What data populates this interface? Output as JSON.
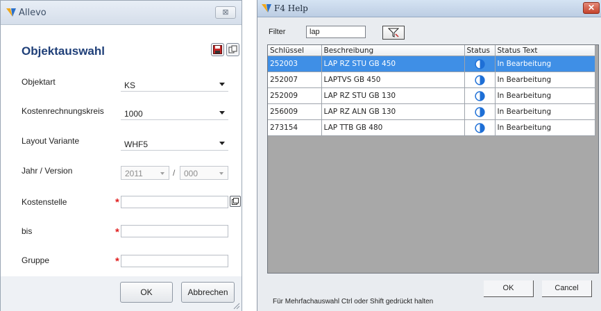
{
  "allevo": {
    "title": "Allevo",
    "close_label": "⊠",
    "heading": "Objektauswahl",
    "fields": {
      "objektart": {
        "label": "Objektart",
        "value": "KS"
      },
      "kostenrechnungskreis": {
        "label": "Kostenrechnungskreis",
        "value": "1000"
      },
      "layout_variante": {
        "label": "Layout Variante",
        "value": "WHF5"
      },
      "jahr_version": {
        "label": "Jahr / Version",
        "year": "2011",
        "separator": "/",
        "version": "000"
      },
      "kostenstelle": {
        "label": "Kostenstelle",
        "value": ""
      },
      "bis": {
        "label": "bis",
        "value": ""
      },
      "gruppe": {
        "label": "Gruppe",
        "value": ""
      }
    },
    "required_marker": "*",
    "ok_label": "OK",
    "cancel_label": "Abbrechen",
    "icons": [
      "allevo-logo-icon",
      "close-icon",
      "save-icon",
      "copy-icon",
      "value-help-icon",
      "resize-grip-icon"
    ]
  },
  "f4": {
    "title": "F4 Help",
    "close_label": "✕",
    "filter_label": "Filter",
    "filter_value": "lap",
    "columns": [
      "Schlüssel",
      "Beschreibung",
      "Status",
      "Status Text"
    ],
    "rows": [
      {
        "key": "252003",
        "desc": "LAP RZ STU GB 450",
        "status_icon": "half-circle-status-icon",
        "status_text": "In Bearbeitung",
        "selected": true
      },
      {
        "key": "252007",
        "desc": "LAPTVS GB 450",
        "status_icon": "half-circle-status-icon",
        "status_text": "In Bearbeitung",
        "selected": false
      },
      {
        "key": "252009",
        "desc": "LAP RZ STU GB 130",
        "status_icon": "half-circle-status-icon",
        "status_text": "In Bearbeitung",
        "selected": false
      },
      {
        "key": "256009",
        "desc": "LAP RZ ALN GB 130",
        "status_icon": "half-circle-status-icon",
        "status_text": "In Bearbeitung",
        "selected": false
      },
      {
        "key": "273154",
        "desc": "LAP TTB GB 480",
        "status_icon": "half-circle-status-icon",
        "status_text": "In Bearbeitung",
        "selected": false
      }
    ],
    "hint": "Für Mehrfachauswahl Ctrl oder Shift gedrückt halten",
    "ok_label": "OK",
    "cancel_label": "Cancel",
    "colors": {
      "selection": "#3f8fe6",
      "heading": "#1f3f78",
      "status_icon": "#1e6fd6",
      "required": "#e02020"
    }
  }
}
